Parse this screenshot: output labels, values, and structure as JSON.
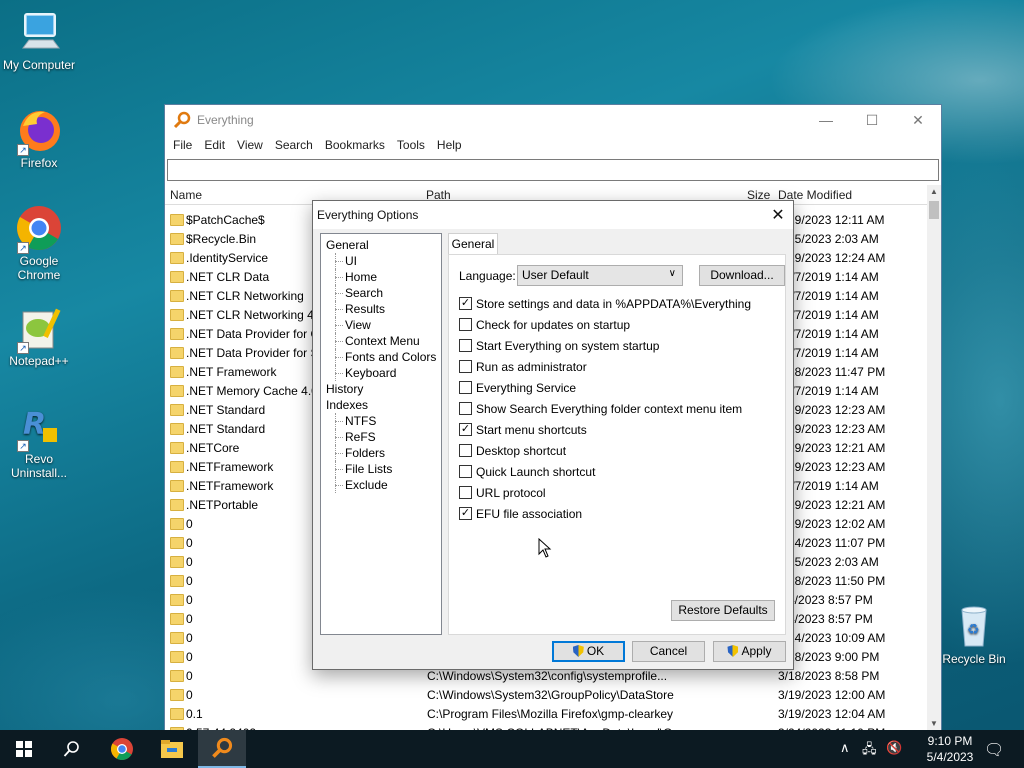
{
  "desktop": {
    "icons": [
      {
        "label": "My Computer"
      },
      {
        "label": "Firefox"
      },
      {
        "label": "Google Chrome"
      },
      {
        "label": "Notepad++"
      },
      {
        "label": "Revo Uninstall..."
      },
      {
        "label": "Recycle Bin"
      }
    ]
  },
  "main_window": {
    "title": "Everything",
    "menu": [
      "File",
      "Edit",
      "View",
      "Search",
      "Bookmarks",
      "Tools",
      "Help"
    ],
    "search_value": "",
    "columns": {
      "name": "Name",
      "path": "Path",
      "size": "Size",
      "date": "Date Modified"
    },
    "rows": [
      {
        "name": "$PatchCache$",
        "path": "",
        "date": "3/19/2023 12:11 AM"
      },
      {
        "name": "$Recycle.Bin",
        "path": "",
        "date": "3/25/2023 2:03 AM"
      },
      {
        "name": ".IdentityService",
        "path": "",
        "date": "3/19/2023 12:24 AM"
      },
      {
        "name": ".NET CLR Data",
        "path": "",
        "date": "12/7/2019 1:14 AM"
      },
      {
        "name": ".NET CLR Networking",
        "path": "",
        "date": "12/7/2019 1:14 AM"
      },
      {
        "name": ".NET CLR Networking 4.0",
        "path": "",
        "date": "12/7/2019 1:14 AM"
      },
      {
        "name": ".NET Data Provider for Or",
        "path": "",
        "date": "12/7/2019 1:14 AM"
      },
      {
        "name": ".NET Data Provider for Sq",
        "path": "",
        "date": "12/7/2019 1:14 AM"
      },
      {
        "name": ".NET Framework",
        "path": "",
        "date": "3/18/2023 11:47 PM"
      },
      {
        "name": ".NET Memory Cache 4.0",
        "path": "",
        "date": "12/7/2019 1:14 AM"
      },
      {
        "name": ".NET Standard",
        "path": "",
        "date": "3/19/2023 12:23 AM"
      },
      {
        "name": ".NET Standard",
        "path": "",
        "date": "3/19/2023 12:23 AM"
      },
      {
        "name": ".NETCore",
        "path": "",
        "date": "3/19/2023 12:21 AM"
      },
      {
        "name": ".NETFramework",
        "path": "",
        "date": "3/19/2023 12:23 AM"
      },
      {
        "name": ".NETFramework",
        "path": "",
        "date": "12/7/2019 1:14 AM"
      },
      {
        "name": ".NETPortable",
        "path": "",
        "date": "3/19/2023 12:21 AM"
      },
      {
        "name": "0",
        "path": "",
        "date": "3/19/2023 12:02 AM"
      },
      {
        "name": "0",
        "path": "",
        "date": "3/24/2023 11:07 PM"
      },
      {
        "name": "0",
        "path": "",
        "date": "3/25/2023 2:03 AM"
      },
      {
        "name": "0",
        "path": "",
        "date": "3/18/2023 11:50 PM"
      },
      {
        "name": "0",
        "path": "",
        "date": "3/4/2023 8:57 PM"
      },
      {
        "name": "0",
        "path": "",
        "date": "3/4/2023 8:57 PM"
      },
      {
        "name": "0",
        "path": "",
        "date": "3/24/2023 10:09 AM"
      },
      {
        "name": "0",
        "path": "",
        "date": "3/18/2023 9:00 PM"
      },
      {
        "name": "0",
        "path": "C:\\Windows\\System32\\config\\systemprofile...",
        "date": "3/18/2023 8:58 PM"
      },
      {
        "name": "0",
        "path": "C:\\Windows\\System32\\GroupPolicy\\DataStore",
        "date": "3/19/2023 12:00 AM"
      },
      {
        "name": "0.1",
        "path": "C:\\Program Files\\Mozilla Firefox\\gmp-clearkey",
        "date": "3/19/2023 12:04 AM"
      },
      {
        "name": "0.57.44.2402",
        "path": "C:\\Users\\VMS COLLABNET\\AppData\\Local\\G...",
        "date": "3/24/2023 11:10 PM"
      }
    ]
  },
  "dialog": {
    "title": "Everything Options",
    "tree": [
      {
        "label": "General",
        "level": 0
      },
      {
        "label": "UI",
        "level": 1
      },
      {
        "label": "Home",
        "level": 1
      },
      {
        "label": "Search",
        "level": 1
      },
      {
        "label": "Results",
        "level": 1
      },
      {
        "label": "View",
        "level": 1
      },
      {
        "label": "Context Menu",
        "level": 1
      },
      {
        "label": "Fonts and Colors",
        "level": 1
      },
      {
        "label": "Keyboard",
        "level": 1
      },
      {
        "label": "History",
        "level": 0
      },
      {
        "label": "Indexes",
        "level": 0
      },
      {
        "label": "NTFS",
        "level": 1
      },
      {
        "label": "ReFS",
        "level": 1
      },
      {
        "label": "Folders",
        "level": 1
      },
      {
        "label": "File Lists",
        "level": 1
      },
      {
        "label": "Exclude",
        "level": 1
      }
    ],
    "tab_label": "General",
    "language_label": "Language:",
    "language_value": "User Default",
    "download_label": "Download...",
    "options": [
      {
        "label": "Store settings and data in %APPDATA%\\Everything",
        "checked": true
      },
      {
        "label": "Check for updates on startup",
        "checked": false
      },
      {
        "label": "Start Everything on system startup",
        "checked": false
      },
      {
        "label": "Run as administrator",
        "checked": false
      },
      {
        "label": "Everything Service",
        "checked": false
      },
      {
        "label": "Show Search Everything folder context menu item",
        "checked": false
      },
      {
        "label": "Start menu shortcuts",
        "checked": true
      },
      {
        "label": "Desktop shortcut",
        "checked": false
      },
      {
        "label": "Quick Launch shortcut",
        "checked": false
      },
      {
        "label": "URL protocol",
        "checked": false
      },
      {
        "label": "EFU file association",
        "checked": true
      }
    ],
    "restore_label": "Restore Defaults",
    "ok_label": "OK",
    "cancel_label": "Cancel",
    "apply_label": "Apply"
  },
  "taskbar": {
    "time": "9:10 PM",
    "date": "5/4/2023"
  }
}
